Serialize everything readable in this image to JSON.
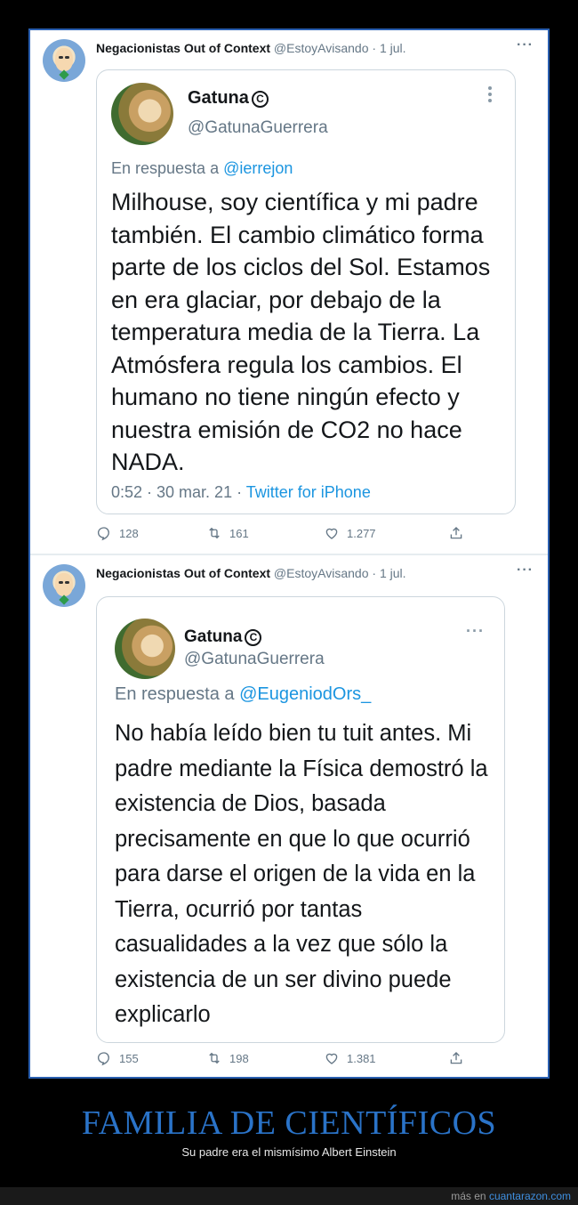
{
  "tweets": [
    {
      "author": {
        "name": "Negacionistas Out of Context",
        "handle": "@EstoyAvisando",
        "date": "· 1 jul."
      },
      "more": "···",
      "quote": {
        "name": "Gatuna",
        "verified_glyph": "C",
        "handle": "@GatunaGuerrera",
        "reply_prefix": "En respuesta a",
        "reply_to": "@ierrejon",
        "text": "Milhouse, soy científica y mi padre también. El cambio climático forma parte de los ciclos del Sol. Estamos en era glaciar, por debajo de la temperatura media de la Tierra. La Atmósfera regula los cambios. El humano no tiene ningún efecto y nuestra emisión de CO2 no hace NADA.",
        "timestamp": "0:52 · 30 mar. 21 ·",
        "source": "Twitter for iPhone"
      },
      "counts": {
        "replies": "128",
        "retweets": "161",
        "likes": "1.277"
      }
    },
    {
      "author": {
        "name": "Negacionistas Out of Context",
        "handle": "@EstoyAvisando",
        "date": "· 1 jul."
      },
      "more": "···",
      "quote": {
        "name": "Gatuna",
        "verified_glyph": "C",
        "handle": "@GatunaGuerrera",
        "reply_prefix": "En respuesta a",
        "reply_to": "@EugeniodOrs_",
        "text": "No había leído bien tu tuit antes. Mi padre mediante la Física demostró la existencia de Dios, basada precisamente en que lo que ocurrió para darse el origen de la vida en la Tierra, ocurrió por tantas casualidades a la vez que sólo la existencia de un ser divino puede explicarlo"
      },
      "counts": {
        "replies": "155",
        "retweets": "198",
        "likes": "1.381"
      }
    }
  ],
  "caption": {
    "title": "FAMILIA DE CIENTÍFICOS",
    "subtitle": "Su padre era el mismísimo Albert Einstein"
  },
  "footer": {
    "prefix": "más en",
    "link": "cuantarazon.com"
  },
  "colors": {
    "accent": "#1b95e0",
    "frame_border": "#2a5fb0",
    "title": "#2a73c8"
  },
  "icons": [
    "reply-icon",
    "retweet-icon",
    "like-icon",
    "share-icon",
    "more-icon"
  ]
}
